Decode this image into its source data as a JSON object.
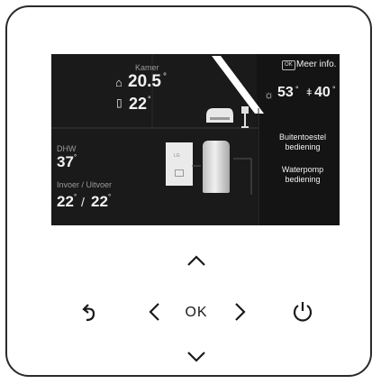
{
  "screen": {
    "room": {
      "label": "Kamer",
      "current_temp": "20.5",
      "set_temp": "22",
      "degree": "°"
    },
    "outdoor": {
      "info_badge": "OK",
      "info_label": "Meer info.",
      "temp_1": "53",
      "temp_2": "40",
      "degree": "°"
    },
    "dhw": {
      "label": "DHW",
      "temp": "37",
      "degree": "°"
    },
    "flow": {
      "label": "Invoer / Uitvoer",
      "inlet": "22",
      "outlet": "22",
      "separator": "/",
      "degree": "°"
    },
    "menu": {
      "item1_line1": "Buitentoestel",
      "item1_line2": "bediening",
      "item2_line1": "Waterpomp",
      "item2_line2": "bediening"
    },
    "unit_brand": "LG"
  },
  "buttons": {
    "ok_label": "OK"
  }
}
